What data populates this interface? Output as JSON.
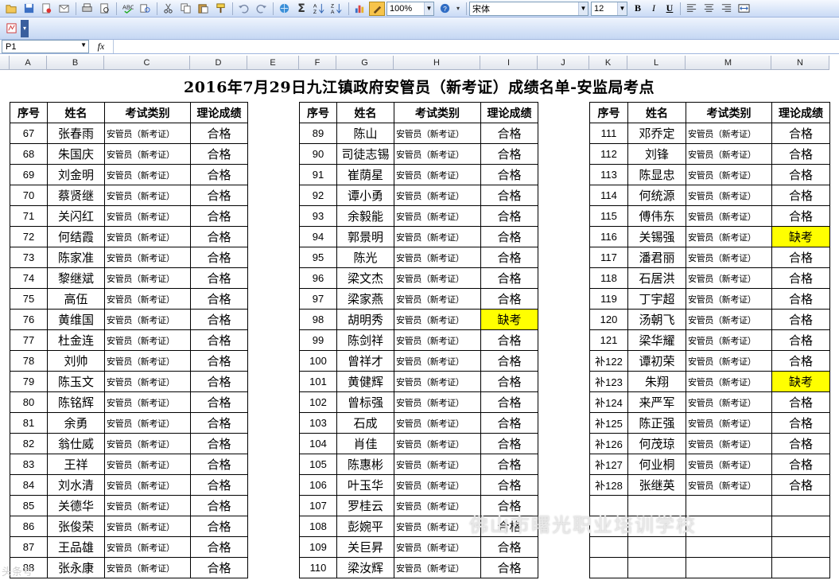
{
  "toolbar": {
    "zoom": "100%",
    "font_name": "宋体",
    "font_size": "12",
    "bold": "B",
    "italic": "I",
    "underline": "U",
    "sigma": "Σ"
  },
  "formula_bar": {
    "cell_ref": "P1",
    "fx": "fx",
    "value": ""
  },
  "columns": [
    "A",
    "B",
    "C",
    "D",
    "E",
    "F",
    "G",
    "H",
    "I",
    "J",
    "K",
    "L",
    "M",
    "N"
  ],
  "sheet": {
    "title": "2016年7月29日九江镇政府安管员（新考证）成绩名单-安监局考点",
    "headers": [
      "序号",
      "姓名",
      "考试类别",
      "理论成绩"
    ],
    "category": "安管员（新考证）",
    "pass": "合格",
    "absent": "缺考",
    "block1": [
      {
        "no": "67",
        "name": "张春雨",
        "res": "合格"
      },
      {
        "no": "68",
        "name": "朱国庆",
        "res": "合格"
      },
      {
        "no": "69",
        "name": "刘金明",
        "res": "合格"
      },
      {
        "no": "70",
        "name": "蔡贤继",
        "res": "合格"
      },
      {
        "no": "71",
        "name": "关闪红",
        "res": "合格"
      },
      {
        "no": "72",
        "name": "何结霞",
        "res": "合格"
      },
      {
        "no": "73",
        "name": "陈家准",
        "res": "合格"
      },
      {
        "no": "74",
        "name": "黎继斌",
        "res": "合格"
      },
      {
        "no": "75",
        "name": "高伍",
        "res": "合格"
      },
      {
        "no": "76",
        "name": "黄维国",
        "res": "合格"
      },
      {
        "no": "77",
        "name": "杜金连",
        "res": "合格"
      },
      {
        "no": "78",
        "name": "刘帅",
        "res": "合格"
      },
      {
        "no": "79",
        "name": "陈玉文",
        "res": "合格"
      },
      {
        "no": "80",
        "name": "陈铭辉",
        "res": "合格"
      },
      {
        "no": "81",
        "name": "余勇",
        "res": "合格"
      },
      {
        "no": "82",
        "name": "翁仕威",
        "res": "合格"
      },
      {
        "no": "83",
        "name": "王祥",
        "res": "合格"
      },
      {
        "no": "84",
        "name": "刘水清",
        "res": "合格"
      },
      {
        "no": "85",
        "name": "关德华",
        "res": "合格"
      },
      {
        "no": "86",
        "name": "张俊荣",
        "res": "合格"
      },
      {
        "no": "87",
        "name": "王品雄",
        "res": "合格"
      },
      {
        "no": "88",
        "name": "张永康",
        "res": "合格"
      }
    ],
    "block2": [
      {
        "no": "89",
        "name": "陈山",
        "res": "合格"
      },
      {
        "no": "90",
        "name": "司徒志锡",
        "res": "合格"
      },
      {
        "no": "91",
        "name": "崔荫星",
        "res": "合格"
      },
      {
        "no": "92",
        "name": "谭小勇",
        "res": "合格"
      },
      {
        "no": "93",
        "name": "余毅能",
        "res": "合格"
      },
      {
        "no": "94",
        "name": "郭景明",
        "res": "合格"
      },
      {
        "no": "95",
        "name": "陈光",
        "res": "合格"
      },
      {
        "no": "96",
        "name": "梁文杰",
        "res": "合格"
      },
      {
        "no": "97",
        "name": "梁家燕",
        "res": "合格"
      },
      {
        "no": "98",
        "name": "胡明秀",
        "res": "缺考"
      },
      {
        "no": "99",
        "name": "陈剑祥",
        "res": "合格"
      },
      {
        "no": "100",
        "name": "曾祥才",
        "res": "合格"
      },
      {
        "no": "101",
        "name": "黄健辉",
        "res": "合格"
      },
      {
        "no": "102",
        "name": "曾标强",
        "res": "合格"
      },
      {
        "no": "103",
        "name": "石成",
        "res": "合格"
      },
      {
        "no": "104",
        "name": "肖佳",
        "res": "合格"
      },
      {
        "no": "105",
        "name": "陈惠彬",
        "res": "合格"
      },
      {
        "no": "106",
        "name": "叶玉华",
        "res": "合格"
      },
      {
        "no": "107",
        "name": "罗桂云",
        "res": "合格"
      },
      {
        "no": "108",
        "name": "彭婉平",
        "res": "合格"
      },
      {
        "no": "109",
        "name": "关巨昇",
        "res": "合格"
      },
      {
        "no": "110",
        "name": "梁汝辉",
        "res": "合格"
      }
    ],
    "block3": [
      {
        "no": "111",
        "name": "邓乔定",
        "res": "合格"
      },
      {
        "no": "112",
        "name": "刘锋",
        "res": "合格"
      },
      {
        "no": "113",
        "name": "陈显忠",
        "res": "合格"
      },
      {
        "no": "114",
        "name": "何统源",
        "res": "合格"
      },
      {
        "no": "115",
        "name": "傅伟东",
        "res": "合格"
      },
      {
        "no": "116",
        "name": "关锡强",
        "res": "缺考"
      },
      {
        "no": "117",
        "name": "潘君丽",
        "res": "合格"
      },
      {
        "no": "118",
        "name": "石居洪",
        "res": "合格"
      },
      {
        "no": "119",
        "name": "丁宇超",
        "res": "合格"
      },
      {
        "no": "120",
        "name": "汤朝飞",
        "res": "合格"
      },
      {
        "no": "121",
        "name": "梁华耀",
        "res": "合格"
      },
      {
        "no": "补122",
        "name": "谭初荣",
        "res": "合格"
      },
      {
        "no": "补123",
        "name": "朱翔",
        "res": "缺考"
      },
      {
        "no": "补124",
        "name": "来严军",
        "res": "合格"
      },
      {
        "no": "补125",
        "name": "陈正强",
        "res": "合格"
      },
      {
        "no": "补126",
        "name": "何茂琼",
        "res": "合格"
      },
      {
        "no": "补127",
        "name": "何业桐",
        "res": "合格"
      },
      {
        "no": "补128",
        "name": "张继英",
        "res": "合格"
      }
    ]
  },
  "watermark": "佛山市曙光职业培训学校",
  "watermark_small": "头条号"
}
